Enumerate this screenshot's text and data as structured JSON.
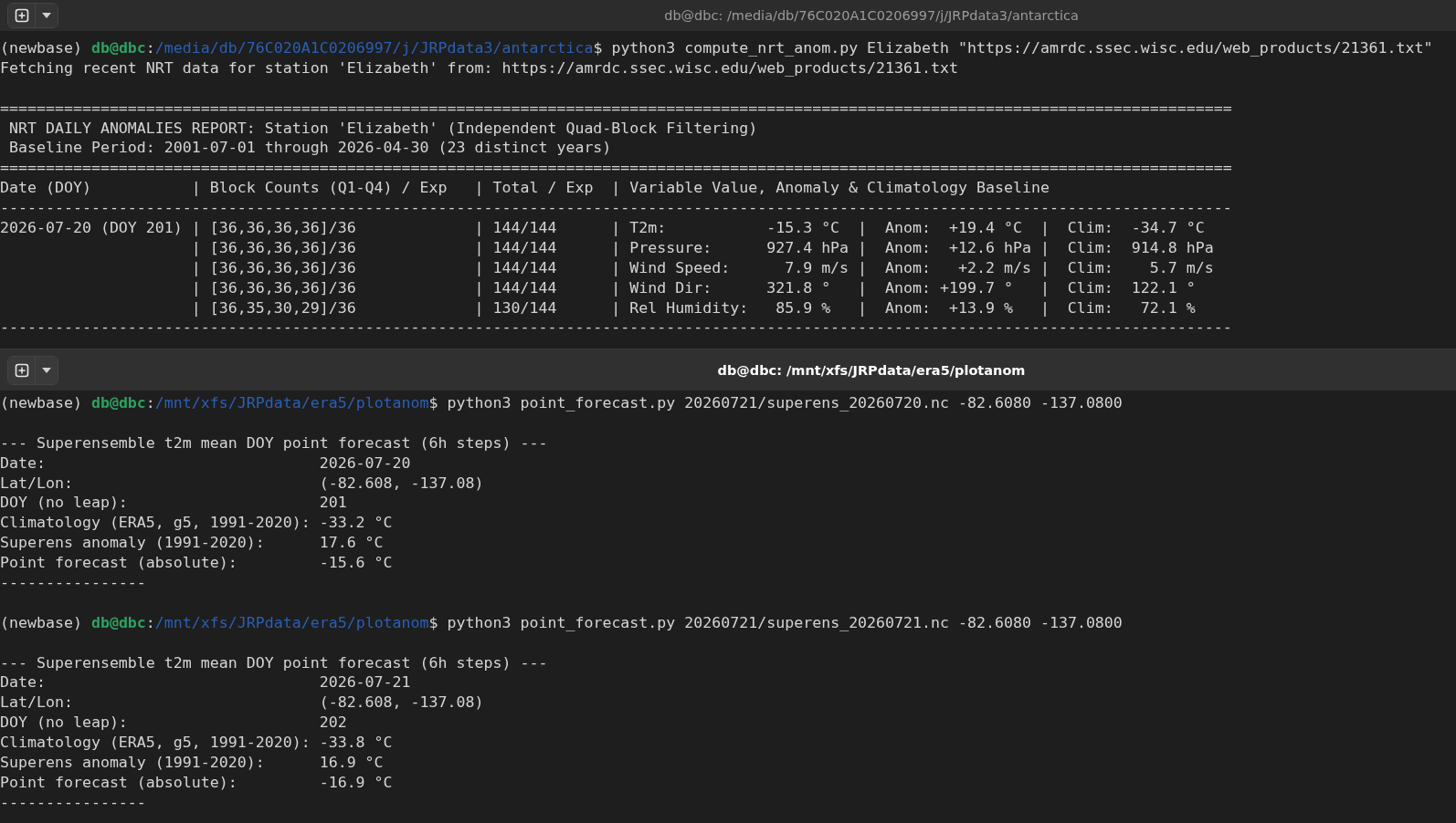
{
  "windows": [
    {
      "title": "db@dbc: /media/db/76C020A1C0206997/j/JRPdata3/antarctica",
      "active": false,
      "lines": [
        {
          "kind": "prompt",
          "segments": [
            {
              "kind": "plain",
              "text": "(newbase) "
            },
            {
              "kind": "user",
              "text": "db@dbc"
            },
            {
              "kind": "plain",
              "text": ":"
            },
            {
              "kind": "path",
              "text": "/media/db/76C020A1C0206997/j/JRPdata3/antarctica"
            },
            {
              "kind": "plain",
              "text": "$ python3 compute_nrt_anom.py Elizabeth \"https://amrdc.ssec.wisc.edu/web_products/21361.txt\""
            }
          ]
        },
        {
          "kind": "text",
          "text": "Fetching recent NRT data for station 'Elizabeth' from: https://amrdc.ssec.wisc.edu/web_products/21361.txt"
        },
        {
          "kind": "blank"
        },
        {
          "kind": "rule",
          "text": "======================================================================================================================================="
        },
        {
          "kind": "text",
          "text": " NRT DAILY ANOMALIES REPORT: Station 'Elizabeth' (Independent Quad-Block Filtering)"
        },
        {
          "kind": "text",
          "text": " Baseline Period: 2001-07-01 through 2026-04-30 (23 distinct years)"
        },
        {
          "kind": "rule",
          "text": "======================================================================================================================================="
        },
        {
          "kind": "text",
          "text": "Date (DOY)           | Block Counts (Q1-Q4) / Exp   | Total / Exp  | Variable Value, Anomaly & Climatology Baseline"
        },
        {
          "kind": "rule",
          "text": "---------------------------------------------------------------------------------------------------------------------------------------"
        },
        {
          "kind": "text",
          "text": "2026-07-20 (DOY 201) | [36,36,36,36]/36             | 144/144      | T2m:           -15.3 °C  |  Anom:  +19.4 °C  |  Clim:  -34.7 °C"
        },
        {
          "kind": "text",
          "text": "                     | [36,36,36,36]/36             | 144/144      | Pressure:      927.4 hPa |  Anom:  +12.6 hPa |  Clim:  914.8 hPa"
        },
        {
          "kind": "text",
          "text": "                     | [36,36,36,36]/36             | 144/144      | Wind Speed:      7.9 m/s |  Anom:   +2.2 m/s |  Clim:    5.7 m/s"
        },
        {
          "kind": "text",
          "text": "                     | [36,36,36,36]/36             | 144/144      | Wind Dir:      321.8 °   |  Anom: +199.7 °   |  Clim:  122.1 °"
        },
        {
          "kind": "text",
          "text": "                     | [36,35,30,29]/36             | 130/144      | Rel Humidity:   85.9 %   |  Anom:  +13.9 %   |  Clim:   72.1 %"
        },
        {
          "kind": "rule",
          "text": "---------------------------------------------------------------------------------------------------------------------------------------"
        }
      ]
    },
    {
      "title": "db@dbc: /mnt/xfs/JRPdata/era5/plotanom",
      "active": true,
      "lines": [
        {
          "kind": "prompt",
          "segments": [
            {
              "kind": "plain",
              "text": "(newbase) "
            },
            {
              "kind": "user",
              "text": "db@dbc"
            },
            {
              "kind": "plain",
              "text": ":"
            },
            {
              "kind": "path",
              "text": "/mnt/xfs/JRPdata/era5/plotanom"
            },
            {
              "kind": "plain",
              "text": "$ python3 point_forecast.py 20260721/superens_20260720.nc -82.6080 -137.0800"
            }
          ]
        },
        {
          "kind": "blank"
        },
        {
          "kind": "text",
          "text": "--- Superensemble t2m mean DOY point forecast (6h steps) ---"
        },
        {
          "kind": "text",
          "text": "Date:                              2026-07-20"
        },
        {
          "kind": "text",
          "text": "Lat/Lon:                           (-82.608, -137.08)"
        },
        {
          "kind": "text",
          "text": "DOY (no leap):                     201"
        },
        {
          "kind": "text",
          "text": "Climatology (ERA5, g5, 1991-2020): -33.2 °C"
        },
        {
          "kind": "text",
          "text": "Superens anomaly (1991-2020):      17.6 °C"
        },
        {
          "kind": "text",
          "text": "Point forecast (absolute):         -15.6 °C"
        },
        {
          "kind": "rule",
          "text": "----------------"
        },
        {
          "kind": "blank"
        },
        {
          "kind": "prompt",
          "segments": [
            {
              "kind": "plain",
              "text": "(newbase) "
            },
            {
              "kind": "user",
              "text": "db@dbc"
            },
            {
              "kind": "plain",
              "text": ":"
            },
            {
              "kind": "path",
              "text": "/mnt/xfs/JRPdata/era5/plotanom"
            },
            {
              "kind": "plain",
              "text": "$ python3 point_forecast.py 20260721/superens_20260721.nc -82.6080 -137.0800"
            }
          ]
        },
        {
          "kind": "blank"
        },
        {
          "kind": "text",
          "text": "--- Superensemble t2m mean DOY point forecast (6h steps) ---"
        },
        {
          "kind": "text",
          "text": "Date:                              2026-07-21"
        },
        {
          "kind": "text",
          "text": "Lat/Lon:                           (-82.608, -137.08)"
        },
        {
          "kind": "text",
          "text": "DOY (no leap):                     202"
        },
        {
          "kind": "text",
          "text": "Climatology (ERA5, g5, 1991-2020): -33.8 °C"
        },
        {
          "kind": "text",
          "text": "Superens anomaly (1991-2020):      16.9 °C"
        },
        {
          "kind": "text",
          "text": "Point forecast (absolute):         -16.9 °C"
        },
        {
          "kind": "rule",
          "text": "----------------"
        }
      ]
    }
  ]
}
